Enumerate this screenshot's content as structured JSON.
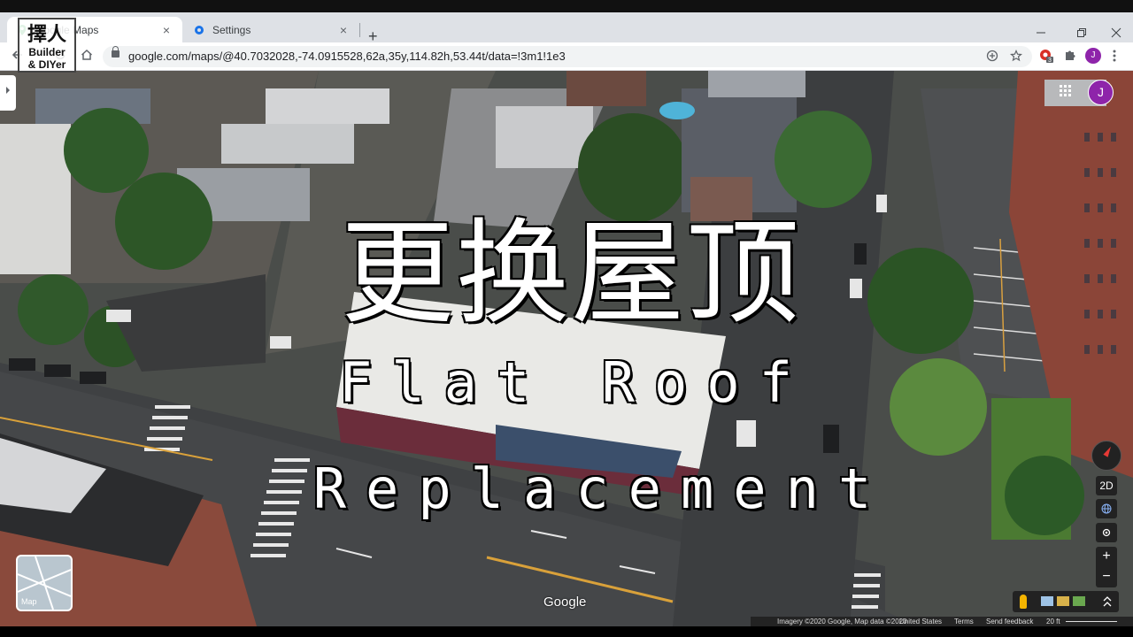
{
  "browser": {
    "tabs": [
      {
        "label": "Google Maps",
        "active": true
      },
      {
        "label": "Settings",
        "active": false
      }
    ],
    "new_tab": "+",
    "tab_close": "×",
    "url": "google.com/maps/@40.7032028,-74.0915528,62a,35y,114.82h,53.44t/data=!3m1!1e3",
    "profile_initial": "J",
    "extension_badge": "3"
  },
  "channel_logo": {
    "line1": "擇人",
    "line2": "Builder",
    "line3": "& DIYer"
  },
  "overlay": {
    "title_zh": "更换屋顶",
    "title_en_line1": "Flat Roof",
    "title_en_line2": "Replacement"
  },
  "map_ui": {
    "profile_initial": "J",
    "view_2d": "2D",
    "zoom_in": "+",
    "zoom_out": "−",
    "minimap_label": "Map",
    "google_logo": "Google",
    "footer": {
      "imagery": "Imagery ©2020 Google, Map data ©2020",
      "region": "United States",
      "terms": "Terms",
      "feedback": "Send feedback",
      "scale": "20 ft"
    }
  },
  "colors": {
    "profile": "#8e24aa",
    "accent_red": "#e53935",
    "pegman": "#f4b400"
  }
}
